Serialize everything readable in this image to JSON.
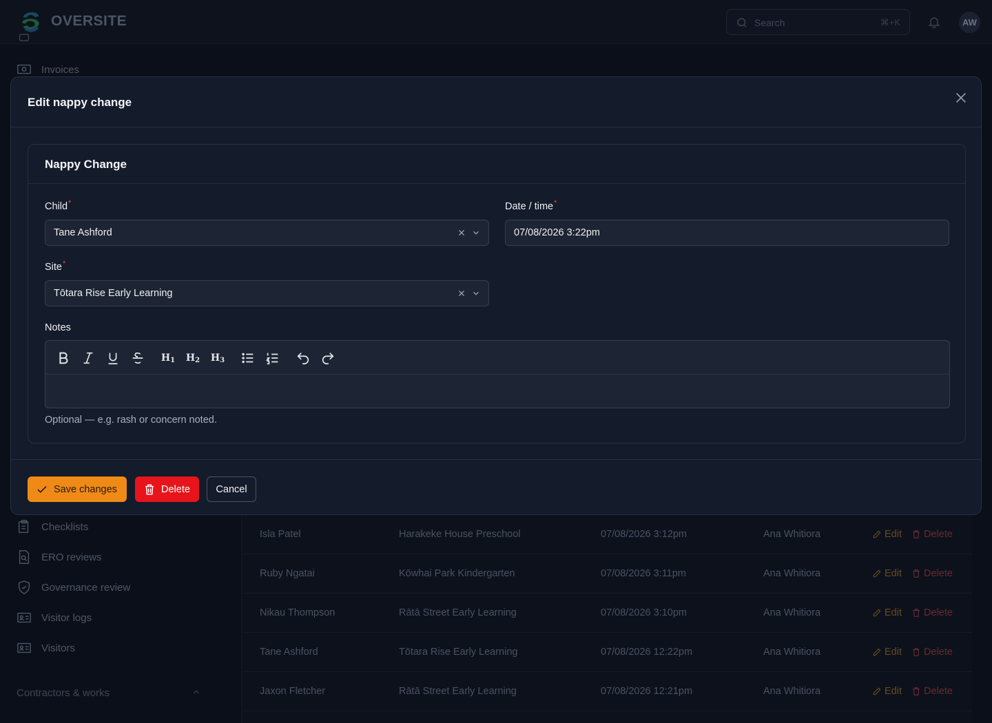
{
  "header": {
    "brand": "OVERSITE",
    "search_placeholder": "Search",
    "search_shortcut": "⌘+K",
    "avatar_initials": "AW"
  },
  "sidebar": {
    "items": [
      {
        "label": "Invoices",
        "icon": "banknote-icon"
      },
      {
        "label": "Checklists",
        "icon": "clipboard-icon"
      },
      {
        "label": "ERO reviews",
        "icon": "document-search-icon"
      },
      {
        "label": "Governance review",
        "icon": "shield-icon"
      },
      {
        "label": "Visitor logs",
        "icon": "id-card-icon"
      },
      {
        "label": "Visitors",
        "icon": "id-card-icon"
      }
    ],
    "section": "Contractors & works"
  },
  "table": {
    "rows": [
      {
        "child": "Isla Patel",
        "site": "Harakeke House Preschool",
        "datetime": "07/08/2026 3:12pm",
        "staff": "Ana Whitiora",
        "edit": "Edit",
        "delete": "Delete"
      },
      {
        "child": "Ruby Ngatai",
        "site": "Kōwhai Park Kindergarten",
        "datetime": "07/08/2026 3:11pm",
        "staff": "Ana Whitiora",
        "edit": "Edit",
        "delete": "Delete"
      },
      {
        "child": "Nikau Thompson",
        "site": "Rātā Street Early Learning",
        "datetime": "07/08/2026 3:10pm",
        "staff": "Ana Whitiora",
        "edit": "Edit",
        "delete": "Delete"
      },
      {
        "child": "Tane Ashford",
        "site": "Tōtara Rise Early Learning",
        "datetime": "07/08/2026 12:22pm",
        "staff": "Ana Whitiora",
        "edit": "Edit",
        "delete": "Delete"
      },
      {
        "child": "Jaxon Fletcher",
        "site": "Rātā Street Early Learning",
        "datetime": "07/08/2026 12:21pm",
        "staff": "Ana Whitiora",
        "edit": "Edit",
        "delete": "Delete"
      }
    ]
  },
  "modal": {
    "title": "Edit nappy change",
    "card_title": "Nappy Change",
    "child": {
      "label": "Child",
      "value": "Tane Ashford"
    },
    "datetime": {
      "label": "Date / time",
      "value": "07/08/2026 3:22pm"
    },
    "site": {
      "label": "Site",
      "value": "Tōtara Rise Early Learning"
    },
    "notes": {
      "label": "Notes",
      "value": "",
      "helper": "Optional — e.g. rash or concern noted."
    },
    "required_marker": "*",
    "buttons": {
      "save": "Save changes",
      "delete": "Delete",
      "cancel": "Cancel"
    }
  },
  "colors": {
    "accent": "#ef8a17",
    "danger": "#e7151b",
    "modal_bg": "#141b2a"
  }
}
